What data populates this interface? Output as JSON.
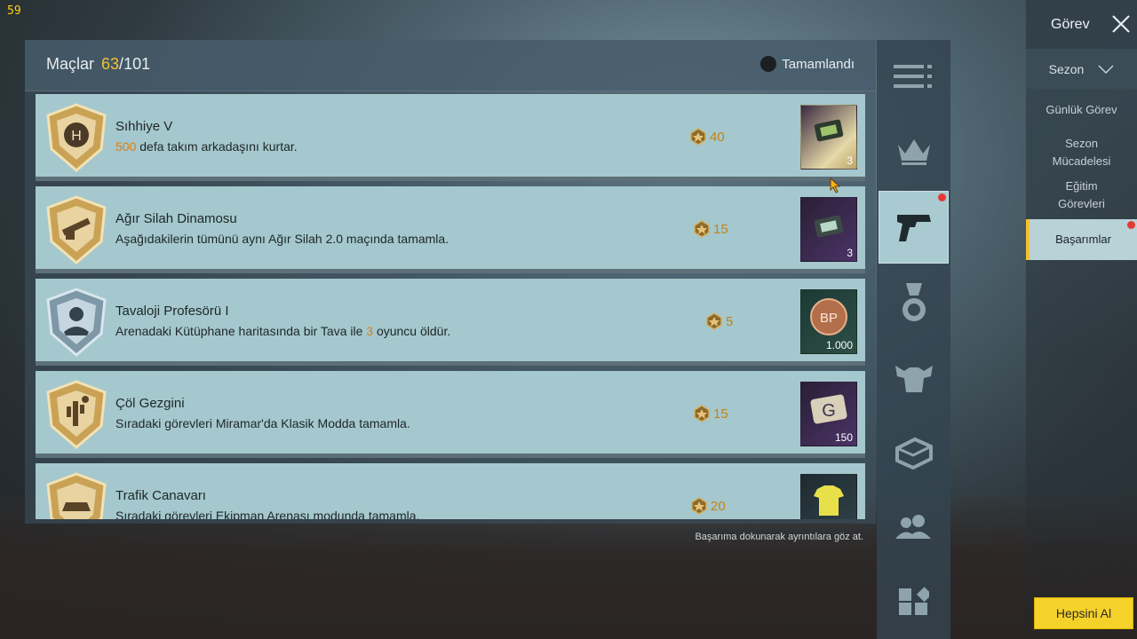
{
  "fps": "59",
  "header": {
    "label": "Maçlar",
    "current": "63",
    "separator": "/",
    "total": "101",
    "status": "Tamamlandı"
  },
  "achievements": [
    {
      "title": "Sıhhiye V",
      "desc_highlight": "500",
      "desc": " defa takım arkadaşını kurtar.",
      "points": "40",
      "reward_qty": "3",
      "badge": "medic-badge-icon",
      "reward_icon": "crate-coupon-icon"
    },
    {
      "title": "Ağır Silah Dinamosu",
      "desc_highlight": "",
      "desc": "Aşağıdakilerin tümünü aynı Ağır Silah 2.0 maçında tamamla.",
      "points": "15",
      "reward_qty": "3",
      "badge": "heavy-weapon-badge-icon",
      "reward_icon": "crate-coupon-icon"
    },
    {
      "title": "Tavaloji Profesörü I",
      "desc_pre": "Arenadaki Kütüphane haritasında bir Tava ile ",
      "desc_highlight": "3",
      "desc": " oyuncu öldür.",
      "points": "5",
      "reward_qty": "1.000",
      "badge": "pan-professor-badge-icon",
      "reward_icon": "bp-coin-icon"
    },
    {
      "title": "Çöl Gezgini",
      "desc_highlight": "",
      "desc": "Sıradaki görevleri Miramar'da Klasik Modda tamamla.",
      "points": "15",
      "reward_qty": "150",
      "badge": "desert-badge-icon",
      "reward_icon": "g-coin-icon"
    },
    {
      "title": "Trafik Canavarı",
      "desc_highlight": "",
      "desc": "Sıradaki görevleri Ekipman Arenası modunda tamamla.",
      "points": "20",
      "reward_qty": "",
      "badge": "car-badge-icon",
      "reward_icon": "tshirt-icon"
    }
  ],
  "hint": "Başarıma dokunarak ayrıntılara göz at.",
  "side_tabs": [
    "list-icon",
    "crown-icon",
    "pistol-icon",
    "medal-icon",
    "muscle-icon",
    "crate-icon",
    "friends-icon",
    "grid-icon"
  ],
  "right_panel": {
    "title": "Görev",
    "season": "Sezon",
    "items": [
      "Günlük Görev",
      "Sezon Mücadelesi",
      "Eğitim Görevleri",
      "Başarımlar"
    ]
  },
  "collect_all": "Hepsini Al",
  "colors": {
    "accent": "#f2c12e",
    "highlight": "#e07d10",
    "row_bg": "#a4c8cd"
  }
}
